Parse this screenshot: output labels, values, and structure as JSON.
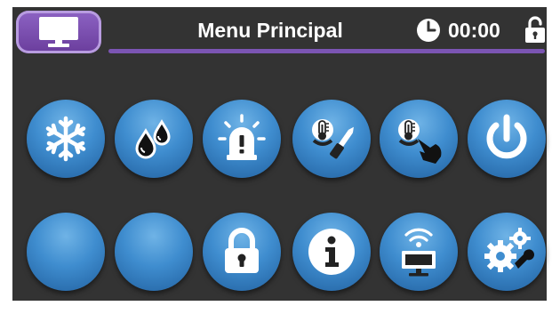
{
  "header": {
    "title": "Menu Principal",
    "time": "00:00",
    "home_icon": "monitor-icon",
    "clock_icon": "clock-icon",
    "lock_icon": "unlock-icon"
  },
  "buttons": [
    {
      "icon": "snowflake-icon"
    },
    {
      "icon": "water-drops-icon"
    },
    {
      "icon": "alarm-light-icon"
    },
    {
      "icon": "thermometer-screwdriver-icon"
    },
    {
      "icon": "thermometer-touch-icon"
    },
    {
      "icon": "power-icon"
    },
    {
      "icon": "blank"
    },
    {
      "icon": "blank"
    },
    {
      "icon": "padlock-icon"
    },
    {
      "icon": "info-icon"
    },
    {
      "icon": "wifi-monitor-icon"
    },
    {
      "icon": "settings-gears-icon"
    }
  ],
  "colors": {
    "background": "#333333",
    "accent_purple": "#7b55b3",
    "button_blue": "#3f8dcf"
  }
}
